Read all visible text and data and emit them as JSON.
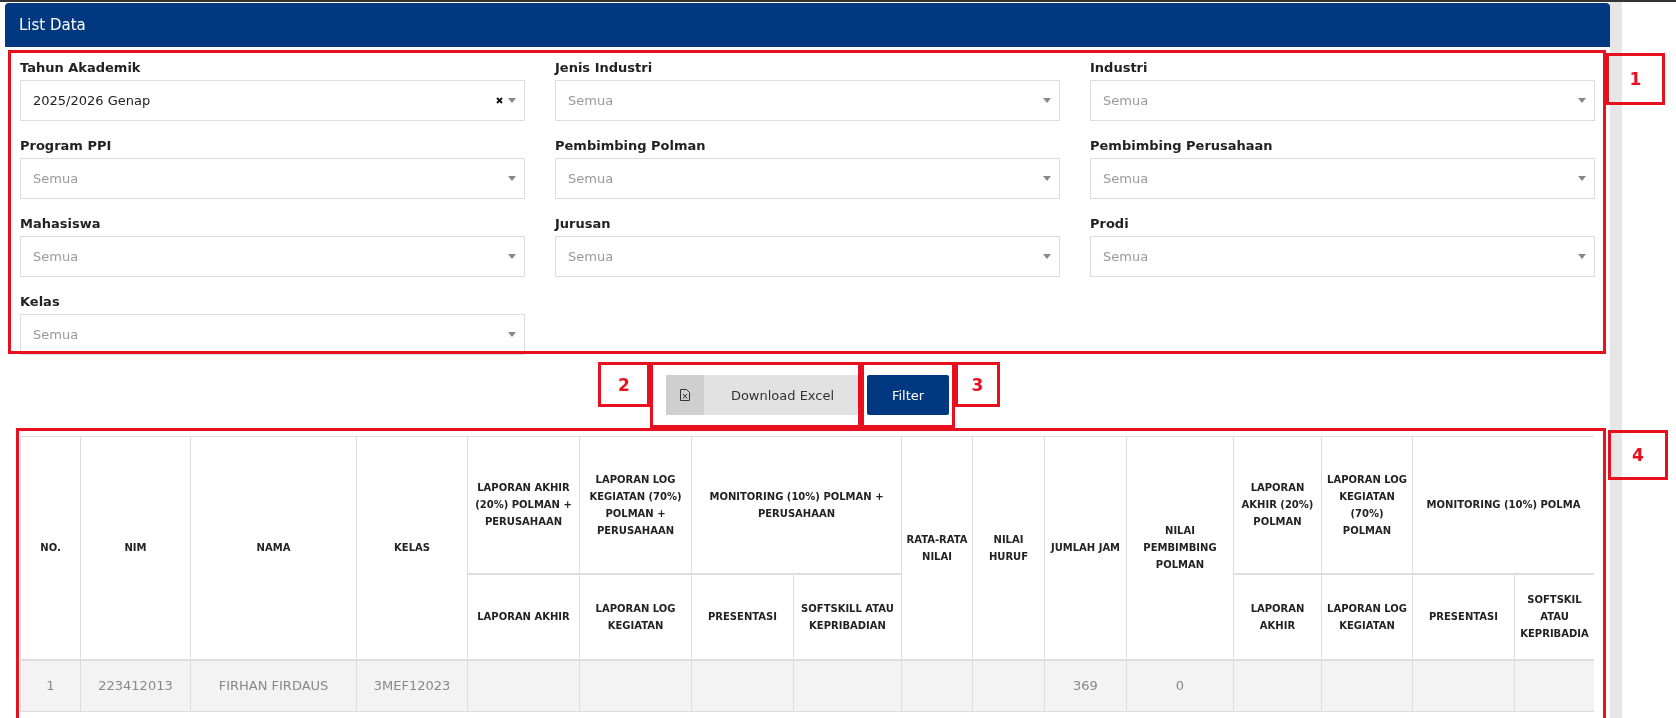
{
  "panel": {
    "title": "List Data"
  },
  "filters": [
    {
      "label": "Tahun Akademik",
      "value": "2025/2026 Genap",
      "clearable": true
    },
    {
      "label": "Jenis Industri",
      "placeholder": "Semua",
      "clearable": false
    },
    {
      "label": "Industri",
      "placeholder": "Semua",
      "clearable": false
    },
    {
      "label": "Program PPI",
      "placeholder": "Semua",
      "clearable": false
    },
    {
      "label": "Pembimbing Polman",
      "placeholder": "Semua",
      "clearable": false
    },
    {
      "label": "Pembimbing Perusahaan",
      "placeholder": "Semua",
      "clearable": false
    },
    {
      "label": "Mahasiswa",
      "placeholder": "Semua",
      "clearable": false
    },
    {
      "label": "Jurusan",
      "placeholder": "Semua",
      "clearable": false
    },
    {
      "label": "Prodi",
      "placeholder": "Semua",
      "clearable": false
    },
    {
      "label": "Kelas",
      "placeholder": "Semua",
      "clearable": false
    }
  ],
  "buttons": [
    {
      "label": "Download Excel",
      "kind": "excel"
    },
    {
      "label": "Filter",
      "kind": "primary"
    }
  ],
  "table": {
    "header": [
      {
        "label": "NO."
      },
      {
        "label": "NIM"
      },
      {
        "label": "NAMA"
      },
      {
        "label": "KELAS"
      },
      {
        "label": "LAPORAN AKHIR (20%) POLMAN + PERUSAHAAN",
        "children": [
          {
            "label": "LAPORAN AKHIR"
          }
        ]
      },
      {
        "label": "LAPORAN LOG KEGIATAN (70%) POLMAN + PERUSAHAAN",
        "children": [
          {
            "label": "LAPORAN LOG KEGIATAN"
          }
        ]
      },
      {
        "label": "MONITORING (10%) POLMAN + PERUSAHAAN",
        "children": [
          {
            "label": "PRESENTASI"
          },
          {
            "label": "SOFTSKILL ATAU KEPRIBADIAN"
          }
        ]
      },
      {
        "label": "RATA-RATA NILAI"
      },
      {
        "label": "NILAI HURUF"
      },
      {
        "label": "JUMLAH JAM"
      },
      {
        "label": "NILAI PEMBIMBING POLMAN"
      },
      {
        "label": "LAPORAN AKHIR (20%) POLMAN",
        "children": [
          {
            "label": "LAPORAN AKHIR"
          }
        ]
      },
      {
        "label": "LAPORAN LOG KEGIATAN (70%) POLMAN",
        "children": [
          {
            "label": "LAPORAN LOG KEGIATAN"
          }
        ]
      },
      {
        "label": "MONITORING (10%) POLMA",
        "children": [
          {
            "label": "PRESENTASI"
          },
          {
            "label": "SOFTSKIL ATAU KEPRIBADIA"
          }
        ]
      }
    ],
    "rows": [
      {
        "cells": [
          "1",
          "223412013",
          "FIRHAN FIRDAUS",
          "3MEF12023",
          null,
          null,
          null,
          null,
          null,
          null,
          "369",
          "0",
          null,
          null,
          null,
          null
        ]
      }
    ]
  },
  "annotations": [
    {
      "label": "1"
    },
    {
      "label": "2"
    },
    {
      "label": "3"
    },
    {
      "label": "4"
    }
  ]
}
